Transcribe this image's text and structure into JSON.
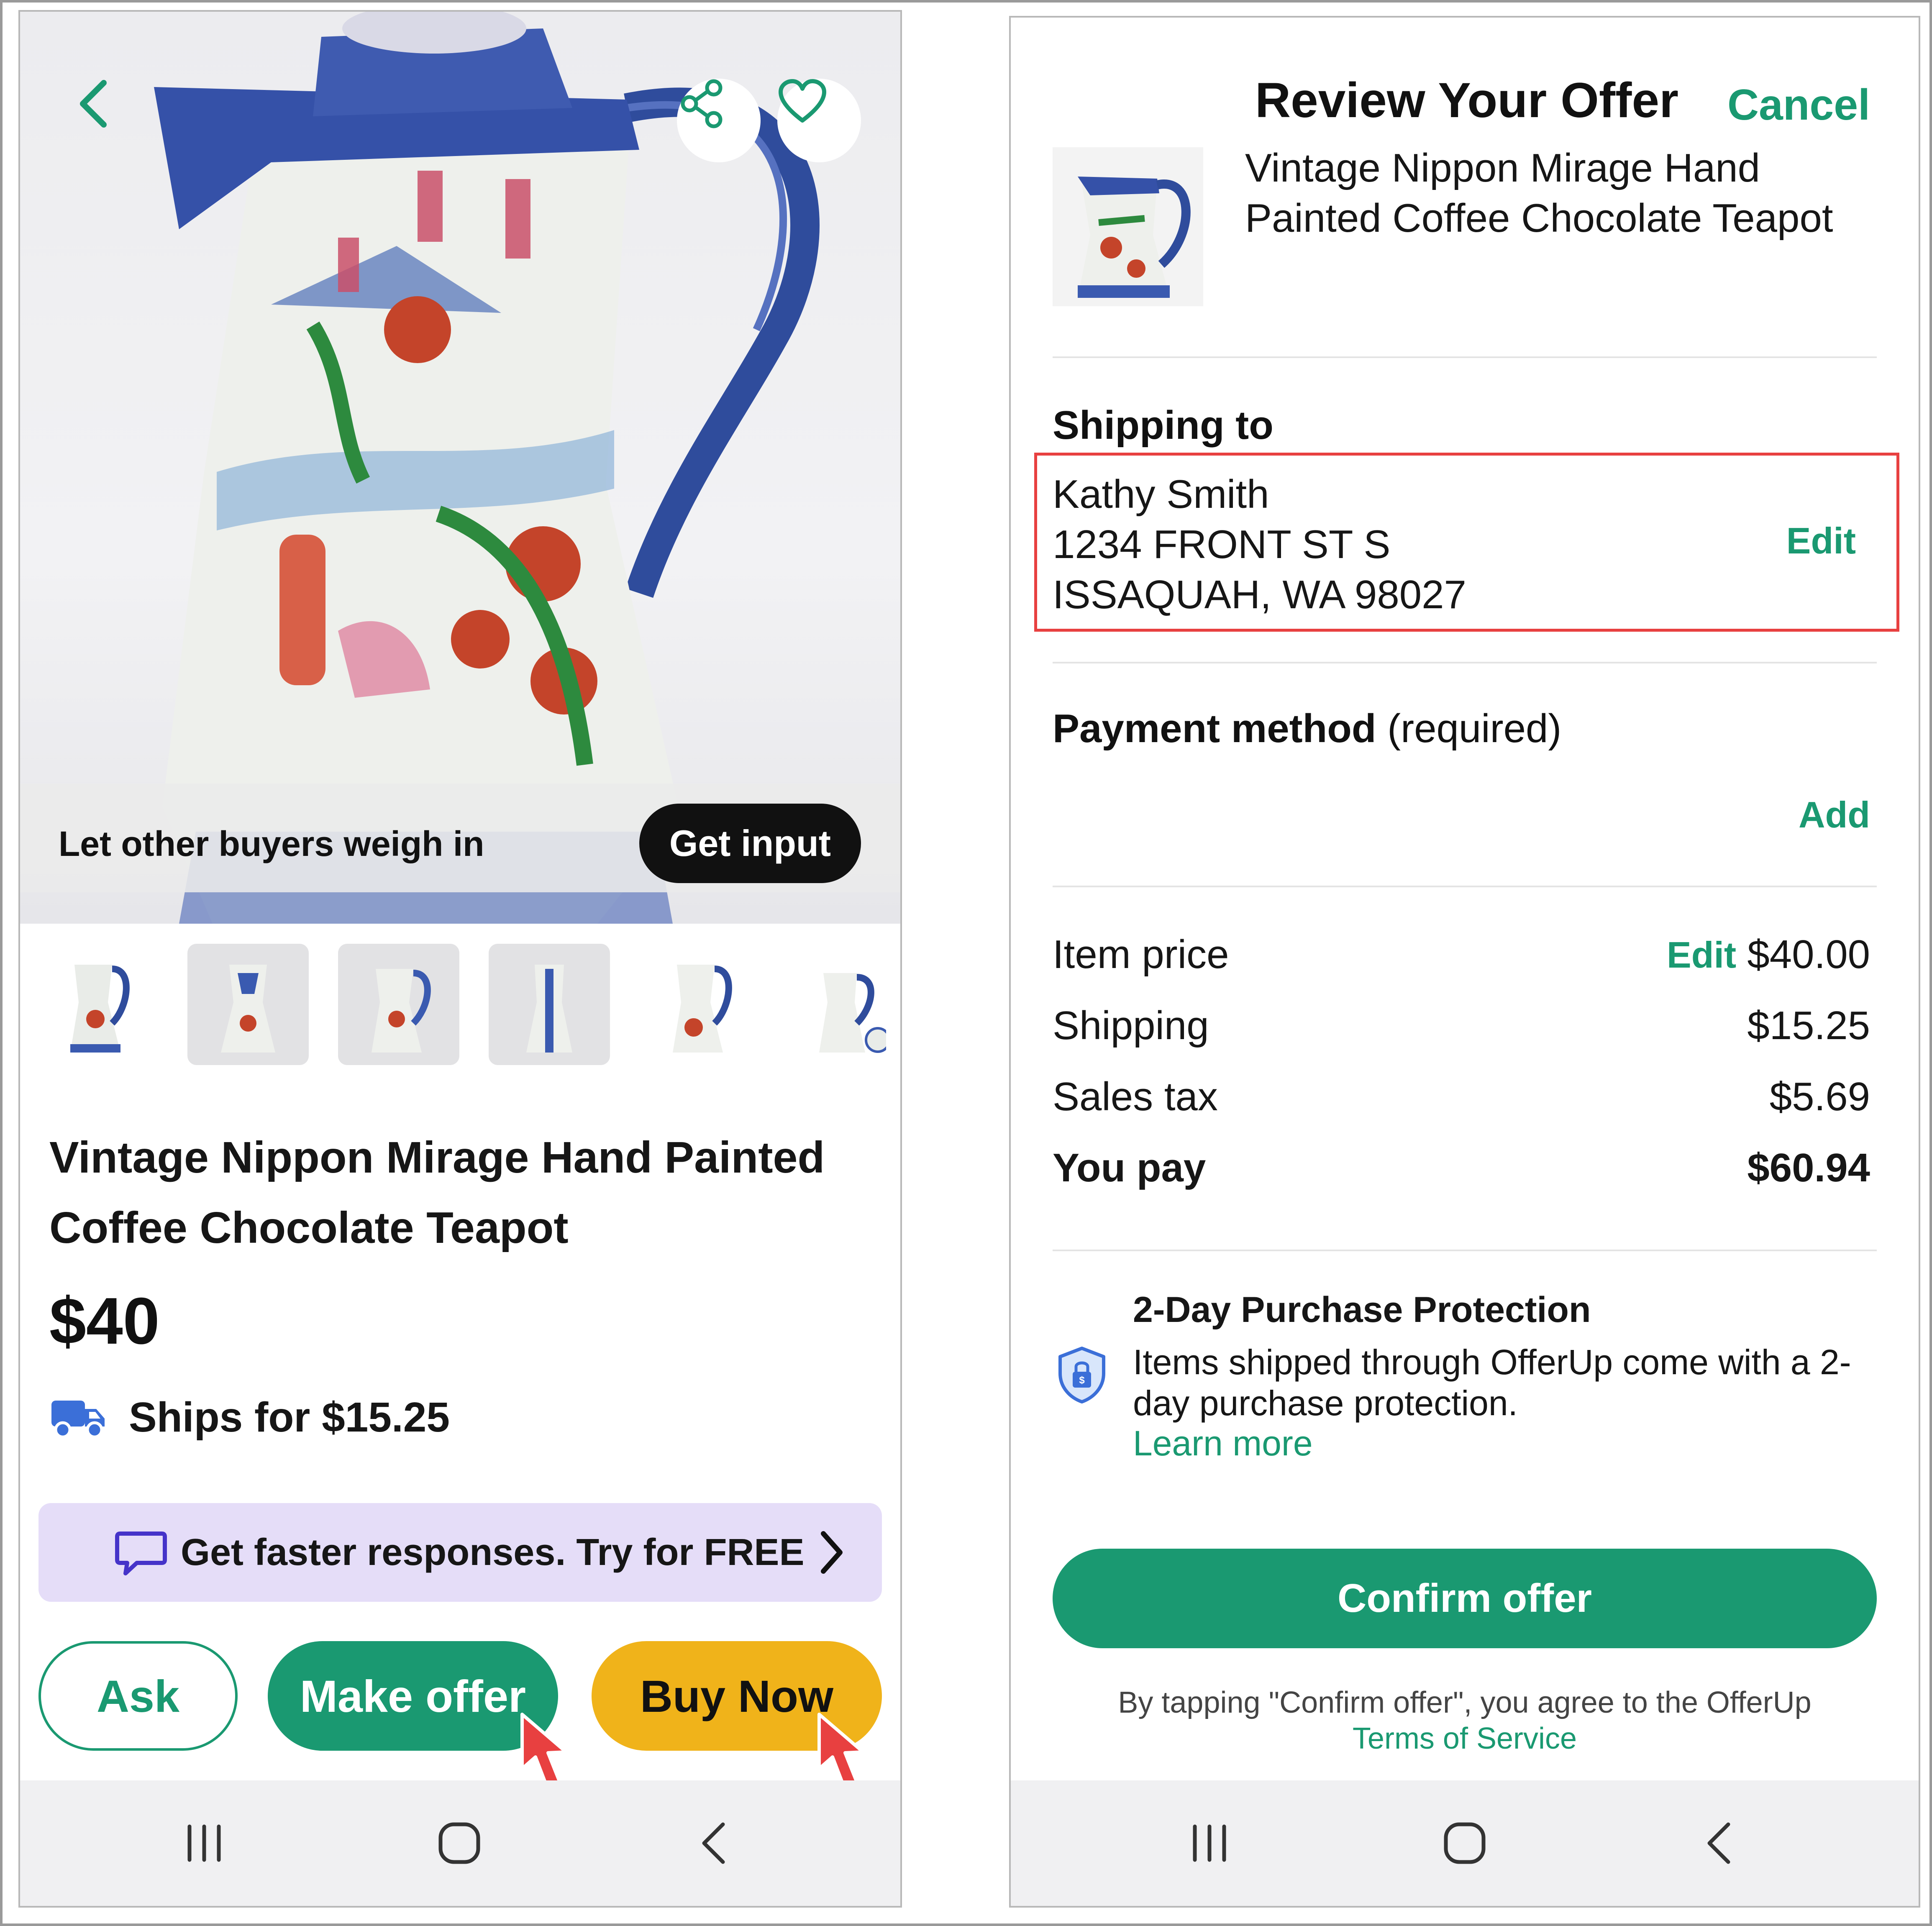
{
  "listing": {
    "get_input_prompt": "Let other buyers weigh in",
    "get_input_button": "Get input",
    "title": "Vintage Nippon Mirage Hand Painted Coffee Chocolate Teapot",
    "price": "$40",
    "shipping": "Ships for $15.25",
    "promo": "Get faster responses. Try for FREE",
    "ask_button": "Ask",
    "make_offer_button": "Make offer",
    "buy_now_button": "Buy Now"
  },
  "review": {
    "title": "Review Your Offer",
    "cancel": "Cancel",
    "product_title": "Vintage Nippon Mirage Hand Painted Coffee Chocolate Teapot",
    "shipping_heading": "Shipping to",
    "address": {
      "name": "Kathy Smith",
      "line1": "1234 FRONT ST S",
      "line2": "ISSAQUAH, WA 98027"
    },
    "address_edit": "Edit",
    "payment_heading": "Payment method",
    "payment_note": "(required)",
    "payment_add": "Add",
    "price_edit": "Edit",
    "rows": [
      {
        "label": "Item price",
        "value": "$40.00"
      },
      {
        "label": "Shipping",
        "value": "$15.25"
      },
      {
        "label": "Sales tax",
        "value": "$5.69"
      },
      {
        "label": "You pay",
        "value": "$60.94"
      }
    ],
    "protection_title": "2-Day Purchase Protection",
    "protection_text": "Items shipped through OfferUp come with a 2-day purchase protection.",
    "learn_more": "Learn more",
    "confirm_button": "Confirm offer",
    "legal_text": "By tapping \"Confirm offer\", you agree to the OfferUp",
    "terms_link": "Terms of Service"
  },
  "colors": {
    "brand_green": "#1a9971",
    "buy_yellow": "#f0b31a",
    "highlight_red": "#e84040",
    "promo_purple": "#e5ddf8"
  },
  "icons": [
    "back-icon",
    "share-icon",
    "heart-icon",
    "truck-icon",
    "chat-icon",
    "chevron-right-icon",
    "shield-icon",
    "recents-icon",
    "home-icon",
    "nav-back-icon",
    "cursor-icon"
  ]
}
